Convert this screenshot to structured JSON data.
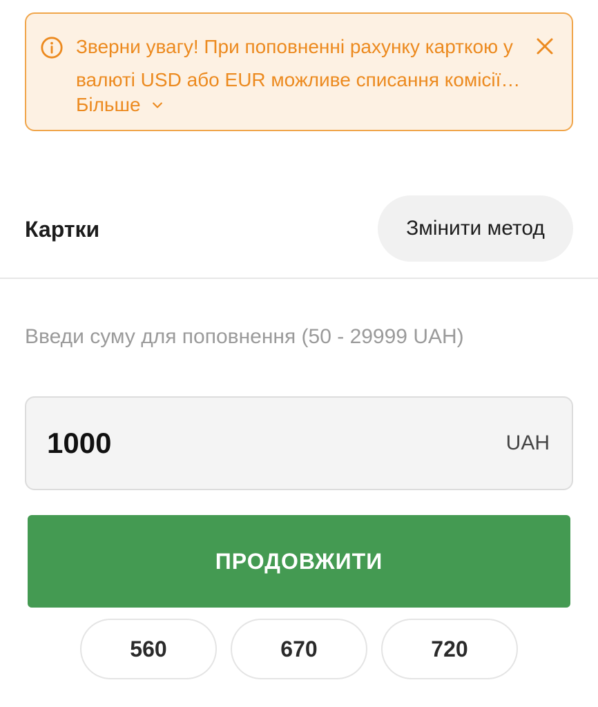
{
  "notice": {
    "line1": "Зверни увагу! При поповненні рахунку карткою у",
    "line2": "валюті USD або EUR можливе списання комісії з...",
    "more_label": "Більше",
    "icons": {
      "info": "info-circle-icon",
      "close": "close-icon",
      "expand": "chevron-down-icon"
    },
    "color": "#ec8a1f",
    "background": "#fdf1e3",
    "border": "#f0a54a"
  },
  "method": {
    "title": "Картки",
    "change_label": "Змінити метод"
  },
  "amount": {
    "label": "Введи суму для поповнення (50 - 29999 UAH)",
    "value": "1000",
    "currency": "UAH"
  },
  "actions": {
    "continue_label": "ПРОДОВЖИТИ",
    "accent": "#449a52"
  },
  "quick_amounts": [
    "560",
    "670",
    "720"
  ]
}
